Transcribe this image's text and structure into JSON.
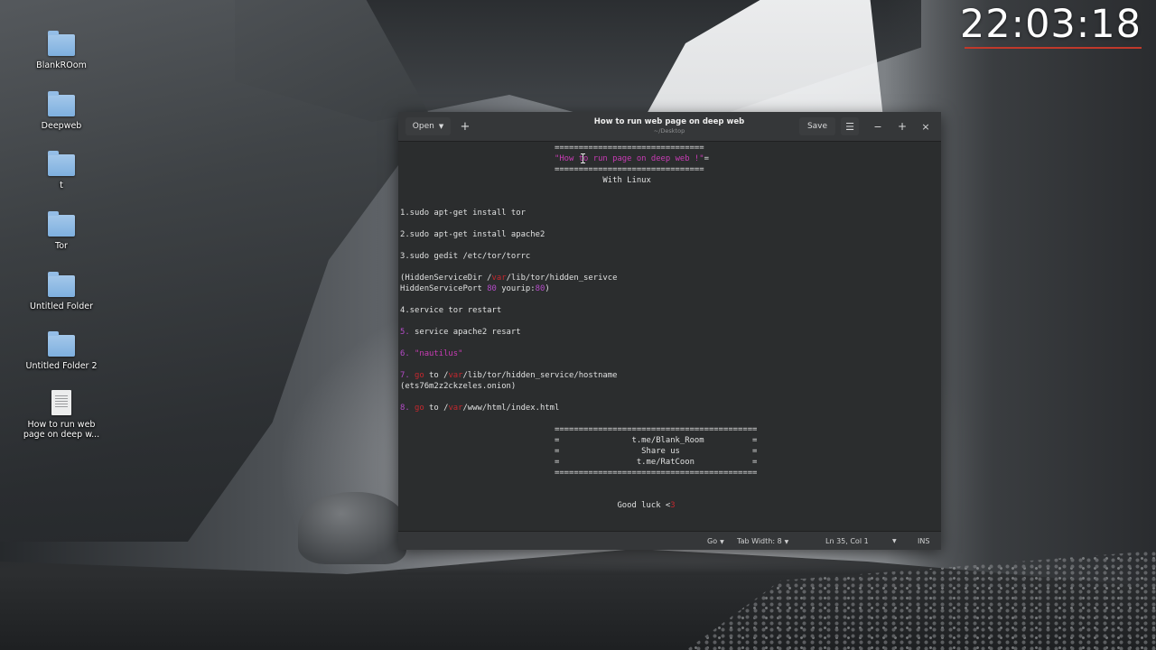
{
  "desktop": {
    "icons": [
      {
        "label": "BlankROom",
        "type": "folder"
      },
      {
        "label": "Deepweb",
        "type": "folder"
      },
      {
        "label": "t",
        "type": "folder"
      },
      {
        "label": "Tor",
        "type": "folder"
      },
      {
        "label": "Untitled Folder",
        "type": "folder"
      },
      {
        "label": "Untitled Folder 2",
        "type": "folder"
      },
      {
        "label": "How to run web page on deep w...",
        "type": "text-file"
      }
    ]
  },
  "clock": {
    "time": "22:03:18"
  },
  "window": {
    "title": "How to run web page on deep web",
    "subtitle": "~/Desktop",
    "buttons": {
      "open": "Open",
      "new": "+",
      "save": "Save",
      "menu": "☰",
      "minimize": "−",
      "maximize": "+",
      "close": "×"
    }
  },
  "editor": {
    "lines": [
      "                                ===============================",
      "                                \"How to run page on deep web !\"=",
      "                                ===============================",
      "                                          With Linux",
      "",
      "",
      "1.sudo apt-get install tor",
      "",
      "2.sudo apt-get install apache2",
      "",
      "3.sudo gedit /etc/tor/torrc",
      "",
      "(HiddenServiceDir /var/lib/tor/hidden_serivce",
      "HiddenServicePort 80 yourip:80)",
      "",
      "4.service tor restart",
      "",
      "5. service apache2 resart",
      "",
      "6. \"nautilus\"",
      "",
      "7. go to /var/lib/tor/hidden_service/hostname",
      "(ets76m2z2ckzeles.onion)",
      "",
      "8. go to /var/www/html/index.html",
      "",
      "                                ==========================================",
      "                                =               t.me/Blank_Room          =",
      "                                =                 Share us               =",
      "                                =                t.me/RatCoon            =",
      "                                ==========================================",
      "",
      "",
      "                                             Good luck <3"
    ]
  },
  "statusbar": {
    "language": "Go",
    "tab_width": "Tab Width: 8",
    "position": "Ln 35, Col 1",
    "mode": "INS"
  },
  "colors": {
    "string": "#c93cb5",
    "keyword": "#c5282e",
    "number": "#b34bc7",
    "accent_line": "#c0392b"
  }
}
